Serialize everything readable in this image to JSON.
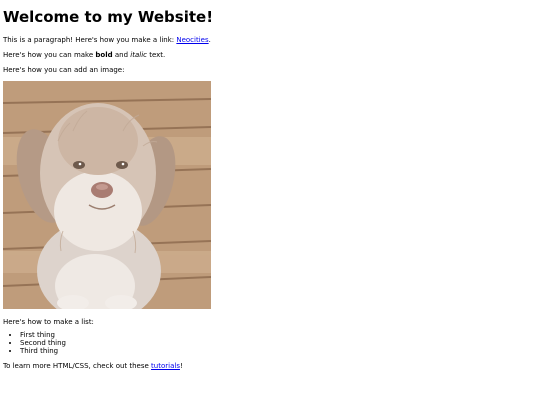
{
  "page": {
    "heading": "Welcome to my Website!",
    "paragraph1": {
      "before": "This is a paragraph! Here's how you make a link: ",
      "link_text": "Neocities",
      "after": "."
    },
    "paragraph2": {
      "before": "Here's how you can make ",
      "bold": "bold",
      "middle": " and ",
      "italic": "italic",
      "after": " text."
    },
    "paragraph3": "Here's how you can add an image:",
    "list_intro": "Here's how to make a list:",
    "list_items": [
      "First thing",
      "Second thing",
      "Third thing"
    ],
    "outro": {
      "before": "To learn more HTML/CSS, check out these ",
      "link_text": "tutorials",
      "after": "!"
    }
  },
  "colors": {
    "link": "#0000ee",
    "text": "#000000",
    "background": "#ffffff"
  },
  "image": {
    "subject": "dog-photo"
  }
}
